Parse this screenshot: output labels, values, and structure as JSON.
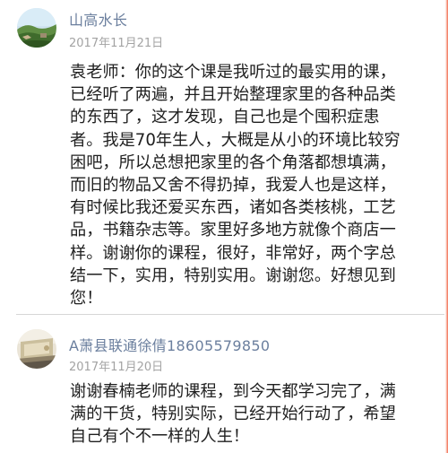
{
  "comments": [
    {
      "author": "山高水长",
      "date": "2017年11月21日",
      "lines": [
        "袁老师：你的这个课是我听过的最实用的课，",
        "已经听了两遍，并且开始整理家里的各种品类",
        "的东西了，这才发现，自己也是个囤积症患",
        "者。我是70年生人，大概是从小的环境比较穷",
        "困吧，所以总想把家里的各个角落都想填满，",
        "而旧的物品又舍不得扔掉，我爱人也是这样，",
        "有时候比我还爱买东西，诸如各类核桃，工艺",
        "品，书籍杂志等。家里好多地方就像个商店一",
        "样。谢谢你的课程，很好，非常好，两个字总",
        "结一下，实用，特别实用。谢谢您。好想见到",
        "您！"
      ]
    },
    {
      "author": "A萧县联通徐倩18605579850",
      "date": "2017年11月20日",
      "lines": [
        "谢谢春楠老师的课程，到今天都学习完了，满",
        "满的干货，特别实际，已经开始行动了，希望",
        "自己有个不一样的人生！"
      ]
    }
  ],
  "colors": {
    "author": "#6b7f9e",
    "date": "#a3a3a3",
    "text": "#1f1f1f",
    "divider": "#d6d6d6",
    "edge_accent": "#f26a4c"
  }
}
